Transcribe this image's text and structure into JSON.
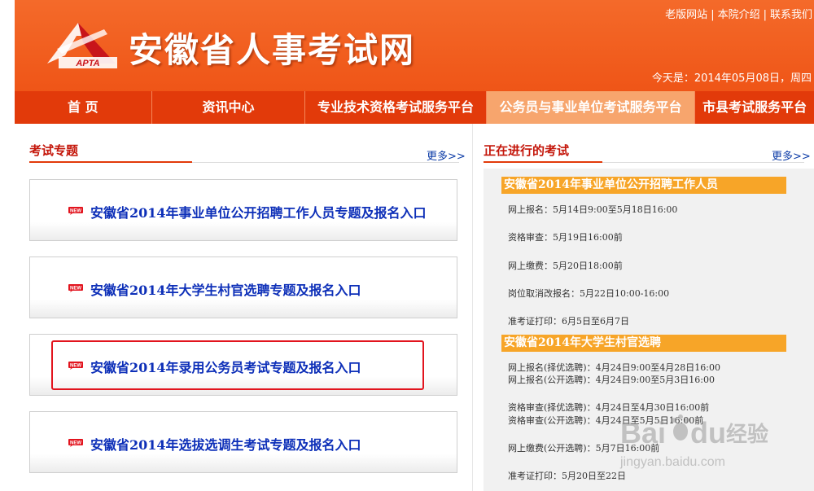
{
  "header": {
    "site_title": "安徽省人事考试网",
    "logo_text": "APTA",
    "links": [
      "老版网站",
      "本院介绍",
      "联系我们"
    ],
    "date_text": "今天是：2014年05月08日，周四"
  },
  "nav": {
    "items": [
      "首 页",
      "资讯中心",
      "专业技术资格考试服务平台",
      "公务员与事业单位考试服务平台",
      "市县考试服务平台"
    ],
    "active_index": 3
  },
  "left": {
    "title": "考试专题",
    "more": "更多>>",
    "topics": [
      "安徽省2014年事业单位公开招聘工作人员专题及报名入口",
      "安徽省2014年大学生村官选聘专题及报名入口",
      "安徽省2014年录用公务员考试专题及报名入口",
      "安徽省2014年选拔选调生考试专题及报名入口"
    ],
    "highlighted_index": 2
  },
  "right": {
    "title": "正在进行的考试",
    "more": "更多>>",
    "exams": [
      {
        "name": "安徽省2014年事业单位公开招聘工作人员",
        "lines": [
          "网上报名：5月14日9:00至5月18日16:00",
          "资格审查：5月19日16:00前",
          "网上缴费：5月20日18:00前",
          "岗位取消改报名：5月22日10:00-16:00",
          "准考证打印：6月5日至6月7日"
        ]
      },
      {
        "name": "安徽省2014年大学生村官选聘",
        "lines": [
          "网上报名(择优选聘)：4月24日9:00至4月28日16:00",
          "网上报名(公开选聘)：4月24日9:00至5月3日16:00",
          "资格审查(择优选聘)：4月24日至4月30日16:00前",
          "资格审查(公开选聘)：4月24日至5月5日16:00前",
          "网上缴费(公开选聘)：5月7日16:00前",
          "准考证打印：5月20日至22日"
        ]
      }
    ]
  },
  "watermark": {
    "brand": "Bai",
    "brand2": "du",
    "suffix": "经验",
    "url": "jingyan.baidu.com"
  },
  "colors": {
    "header_orange": "#f05a1e",
    "nav_red": "#e23a0a",
    "nav_active": "#f7a56d",
    "link_blue": "#0d2fb8",
    "exam_head": "#f7a528",
    "highlight": "#e2141e"
  },
  "icons": {
    "new_badge": "new-badge-icon",
    "logo": "apta-logo-icon"
  }
}
